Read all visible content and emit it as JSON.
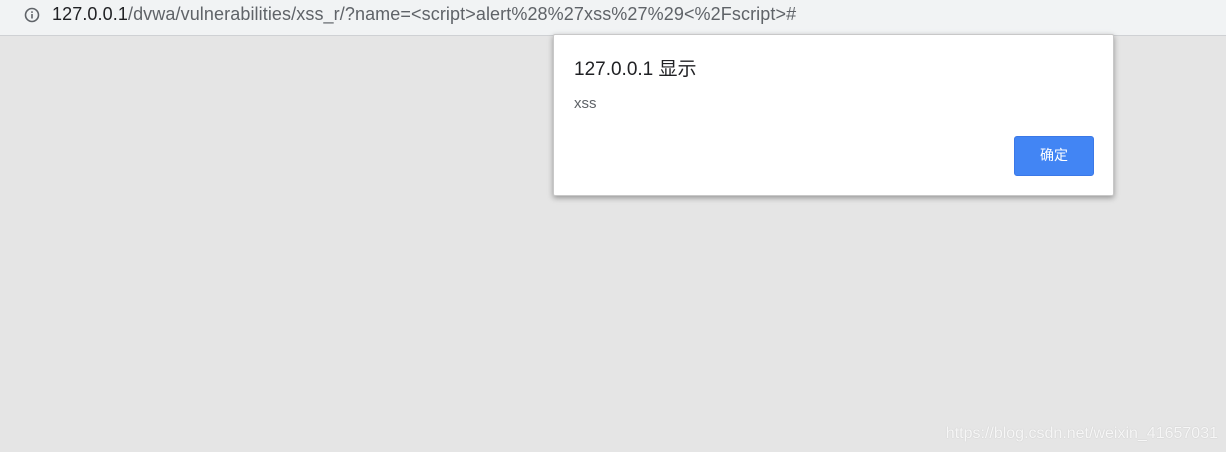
{
  "address_bar": {
    "icon": "info-icon",
    "url_host": "127.0.0.1",
    "url_path": "/dvwa/vulnerabilities/xss_r/?name=<script>alert%28%27xss%27%29<%2Fscript>#"
  },
  "dialog": {
    "title": "127.0.0.1 显示",
    "message": "xss",
    "ok_label": "确定"
  },
  "watermark": {
    "text": "https://blog.csdn.net/weixin_41657031"
  },
  "colors": {
    "page_background": "#e5e5e5",
    "address_bar_background": "#f1f3f4",
    "button_blue": "#4285f4",
    "dialog_background": "#ffffff"
  }
}
